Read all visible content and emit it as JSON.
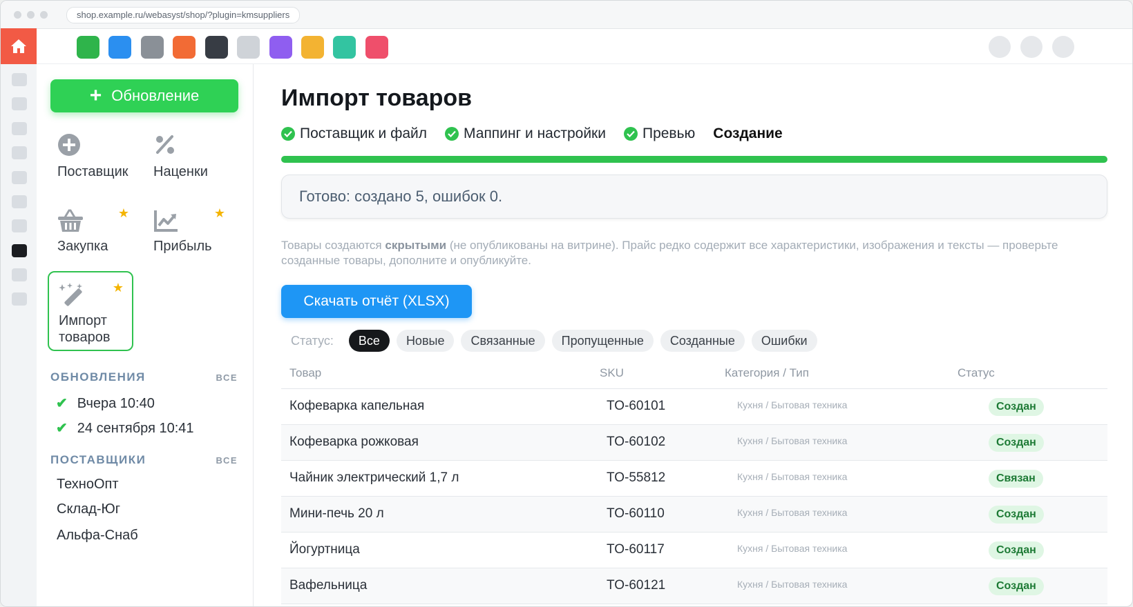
{
  "browser": {
    "url": "shop.example.ru/webasyst/shop/?plugin=kmsuppliers"
  },
  "appbar": {
    "home_icon": "home-icon",
    "app_colors": [
      "#2fb44b",
      "#2b8ff0",
      "#8a9097",
      "#f26b35",
      "#373c44",
      "#cfd3d8",
      "#8f5ef0",
      "#f3b332",
      "#33c4a1",
      "#ef4f6b"
    ]
  },
  "sidebar": {
    "update_button": "Обновление",
    "tiles": [
      {
        "label": "Поставщик",
        "icon": "plus-circle-icon",
        "starred": false
      },
      {
        "label": "Наценки",
        "icon": "percent-icon",
        "starred": false
      },
      {
        "label": "Закупка",
        "icon": "basket-icon",
        "starred": true
      },
      {
        "label": "Прибыль",
        "icon": "chart-icon",
        "starred": true
      },
      {
        "label": "Импорт товаров",
        "icon": "magic-wand-icon",
        "starred": true,
        "active": true
      }
    ],
    "updates_title": "ОБНОВЛЕНИЯ",
    "updates_all": "ВСЕ",
    "updates": [
      "Вчера 10:40",
      "24 сентября 10:41"
    ],
    "suppliers_title": "ПОСТАВЩИКИ",
    "suppliers_all": "ВСЕ",
    "suppliers": [
      "ТехноОпт",
      "Склад-Юг",
      "Альфа-Снаб"
    ]
  },
  "main": {
    "title": "Импорт товаров",
    "steps": [
      {
        "label": "Поставщик и файл",
        "done": true
      },
      {
        "label": "Маппинг и настройки",
        "done": true
      },
      {
        "label": "Превью",
        "done": true
      },
      {
        "label": "Создание",
        "done": false,
        "current": true
      }
    ],
    "progress": 1.0,
    "result": "Готово: создано 5, ошибок 0.",
    "note_before": "Товары создаются ",
    "note_bold": "скрытыми",
    "note_after": " (не опубликованы на витрине). Прайс редко содержит все характеристики, изображения и тексты — проверьте созданные товары, дополните и опубликуйте.",
    "report_button": "Скачать отчёт (XLSX)",
    "filter_label": "Статус:",
    "filters": [
      "Все",
      "Новые",
      "Связанные",
      "Пропущенные",
      "Созданные",
      "Ошибки"
    ],
    "active_filter": "Все",
    "table": {
      "headers": [
        "Товар",
        "SKU",
        "Категория / Тип",
        "Статус"
      ],
      "rows": [
        {
          "name": "Кофеварка капельная",
          "sku": "TO-60101",
          "category": "Кухня / Бытовая техника",
          "status": "Создан"
        },
        {
          "name": "Кофеварка рожковая",
          "sku": "TO-60102",
          "category": "Кухня / Бытовая техника",
          "status": "Создан"
        },
        {
          "name": "Чайник электрический 1,7 л",
          "sku": "TO-55812",
          "category": "Кухня / Бытовая техника",
          "status": "Связан"
        },
        {
          "name": "Мини-печь 20 л",
          "sku": "TO-60110",
          "category": "Кухня / Бытовая техника",
          "status": "Создан"
        },
        {
          "name": "Йогуртница",
          "sku": "TO-60117",
          "category": "Кухня / Бытовая техника",
          "status": "Создан"
        },
        {
          "name": "Вафельница",
          "sku": "TO-60121",
          "category": "Кухня / Бытовая техника",
          "status": "Создан"
        }
      ]
    }
  }
}
